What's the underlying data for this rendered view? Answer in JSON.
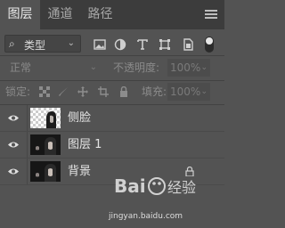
{
  "tabs": [
    {
      "label": "图层",
      "active": true
    },
    {
      "label": "通道",
      "active": false
    },
    {
      "label": "路径",
      "active": false
    }
  ],
  "filter": {
    "kind_label": "类型",
    "search_icon": "search-icon",
    "icons": [
      "image-filter-icon",
      "adjustment-filter-icon",
      "type-filter-icon",
      "shape-filter-icon",
      "smart-object-filter-icon"
    ]
  },
  "blend": {
    "mode": "正常",
    "opacity_label": "不透明度:",
    "opacity_value": "100%"
  },
  "locks": {
    "label": "锁定:",
    "fill_label": "填充:",
    "fill_value": "100%"
  },
  "layers": [
    {
      "name": "侧脸",
      "thumbnail": "transparent-with-figure",
      "visible": true,
      "locked": false
    },
    {
      "name": "图层 1",
      "thumbnail": "photo",
      "visible": true,
      "locked": false
    },
    {
      "name": "背景",
      "thumbnail": "photo",
      "visible": true,
      "locked": true
    }
  ],
  "watermark": {
    "brand": "Bai经验",
    "url": "jingyan.baidu.com"
  },
  "colors": {
    "panel": "#535353",
    "tabbar": "#3c3c3c"
  }
}
